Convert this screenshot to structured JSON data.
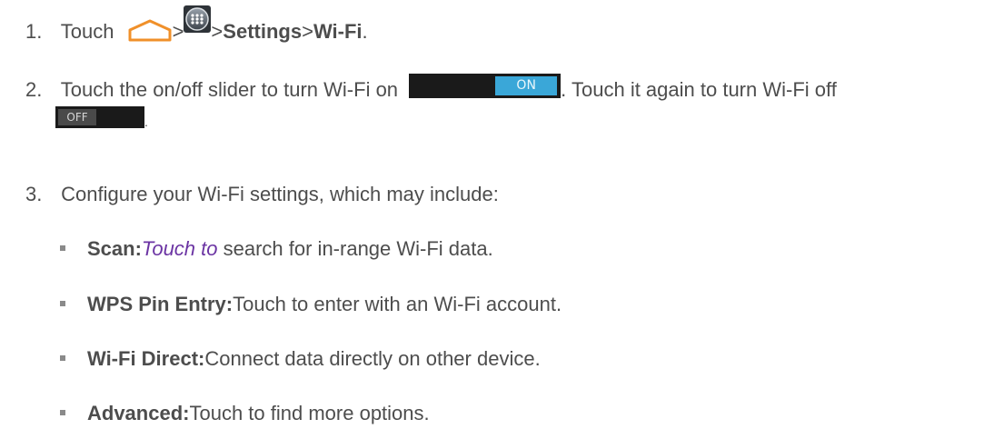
{
  "steps": {
    "s1": {
      "number": "1.",
      "touch": "Touch",
      "sep1": ">",
      "sep2": ">",
      "settings": "Settings",
      "sep3": ">",
      "wifi": "Wi-Fi",
      "end": "."
    },
    "s2": {
      "number": "2.",
      "text_a": "Touch the on/off slider to turn Wi-Fi on",
      "on_label": "ON",
      "text_b": ". Touch it again to turn Wi-Fi off",
      "off_label": "OFF",
      "end": "."
    },
    "s3": {
      "number": "3.",
      "text": "Configure your Wi-Fi settings, which may include:"
    }
  },
  "bullets": [
    {
      "term": "Scan:",
      "link": "Touch to",
      "desc": " search for in-range Wi-Fi data."
    },
    {
      "term": "WPS Pin Entry:",
      "desc": "Touch to enter with an Wi-Fi account."
    },
    {
      "term": "Wi-Fi Direct:",
      "desc": "Connect data directly on other device."
    },
    {
      "term": "Advanced:",
      "desc": "Touch to find more options."
    }
  ],
  "icons": {
    "home": "home-icon",
    "apps": "apps-icon"
  },
  "colors": {
    "text": "#4d4d4d",
    "home_icon": "#f0902a",
    "slider_on": "#3aa7d8",
    "slider_track": "#1a1a1a",
    "link": "#6b34a3"
  }
}
